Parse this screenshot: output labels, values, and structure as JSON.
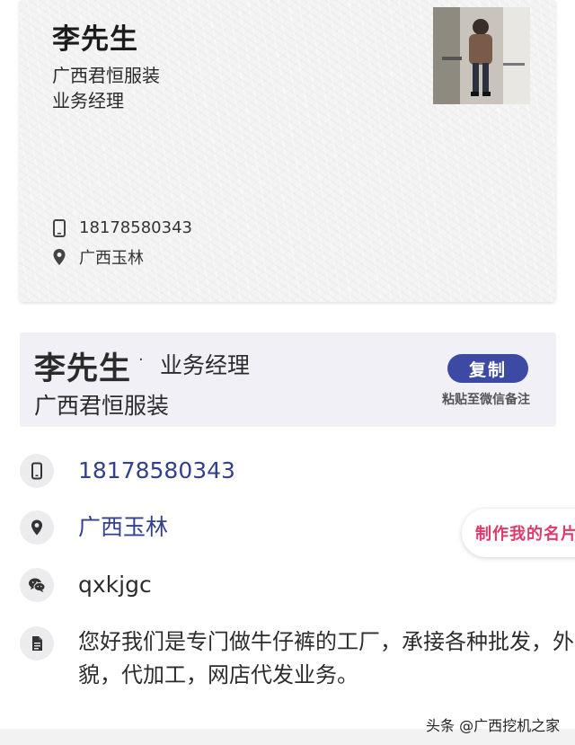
{
  "card": {
    "name": "李先生",
    "company": "广西君恒服装",
    "title": "业务经理",
    "phone": "18178580343",
    "location": "广西玉林"
  },
  "info": {
    "name": "李先生",
    "separator": "·",
    "title": "业务经理",
    "company": "广西君恒服装",
    "copy_label": "复制",
    "copy_hint": "粘贴至微信备注"
  },
  "contacts": {
    "phone": "18178580343",
    "address": "广西玉林",
    "wechat": "qxkjgc",
    "intro": "您好我们是专门做牛仔裤的工厂，承接各种批发，外貌，代加工，网店代发业务。"
  },
  "make_card_label": "制作我的名片",
  "watermark": "头条 @广西挖机之家",
  "colors": {
    "accent": "#3d4aa3",
    "link": "#32408e",
    "pink": "#e03a6a",
    "header_bg": "#f0f0f6"
  }
}
